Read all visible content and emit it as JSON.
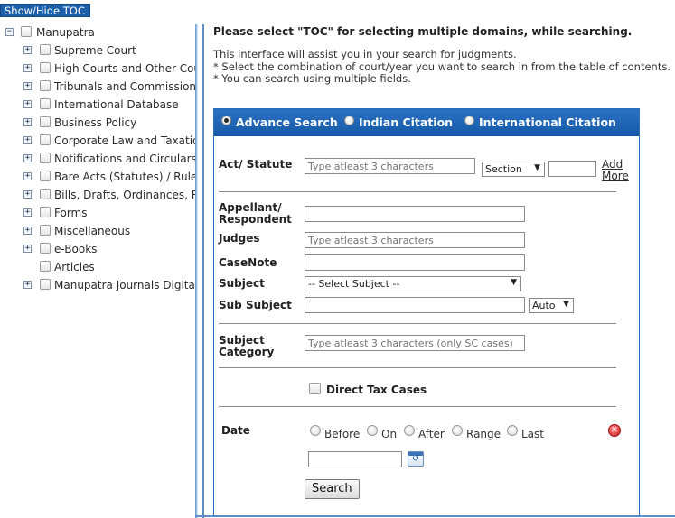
{
  "toc_toggle_label": "Show/Hide TOC",
  "tree": {
    "root_label": "Manupatra",
    "items": [
      {
        "label": "Supreme Court",
        "expandable": true
      },
      {
        "label": "High Courts and Other Courts",
        "expandable": true
      },
      {
        "label": "Tribunals and Commissions",
        "expandable": true
      },
      {
        "label": "International Database",
        "expandable": true
      },
      {
        "label": "Business Policy",
        "expandable": true
      },
      {
        "label": "Corporate Law and Taxation",
        "expandable": true
      },
      {
        "label": "Notifications and Circulars",
        "expandable": true
      },
      {
        "label": "Bare Acts (Statutes) / Rules",
        "expandable": true
      },
      {
        "label": "Bills, Drafts, Ordinances, Reports",
        "expandable": true
      },
      {
        "label": "Forms",
        "expandable": true
      },
      {
        "label": "Miscellaneous",
        "expandable": true
      },
      {
        "label": "e-Books",
        "expandable": true
      },
      {
        "label": "Articles",
        "expandable": false
      },
      {
        "label": "Manupatra Journals Digital Edition",
        "expandable": true
      }
    ]
  },
  "main": {
    "heading": "Please select  \"TOC\"  for selecting multiple domains, while searching.",
    "info_lines": [
      "This interface will assist you in your search for judgments.",
      "* Select the combination of court/year you want to search in from the table of contents.",
      "* You can search using multiple fields."
    ]
  },
  "search_modes": {
    "advance": "Advance Search",
    "indian_citation": "Indian Citation",
    "international_citation": "International Citation",
    "selected": "advance"
  },
  "form": {
    "act_label": "Act/ Statute",
    "act_placeholder": "Type atleast 3 characters",
    "section_select": "Section",
    "add_more_line1": "Add",
    "add_more_line2": "More",
    "appellant_label_line1": "Appellant/",
    "appellant_label_line2": "Respondent",
    "judges_label": "Judges",
    "judges_placeholder": "Type atleast 3 characters",
    "casenote_label": "CaseNote",
    "subject_label": "Subject",
    "subject_select": "-- Select Subject --",
    "subsubject_label": "Sub Subject",
    "auto_select": "Auto",
    "subject_category_label_line1": "Subject",
    "subject_category_label_line2": "Category",
    "subject_category_placeholder": "Type atleast 3 characters (only SC cases)",
    "direct_tax_label": "Direct Tax Cases",
    "date_label": "Date",
    "date_options": [
      "Before",
      "On",
      "After",
      "Range",
      "Last"
    ],
    "search_button": "Search"
  }
}
